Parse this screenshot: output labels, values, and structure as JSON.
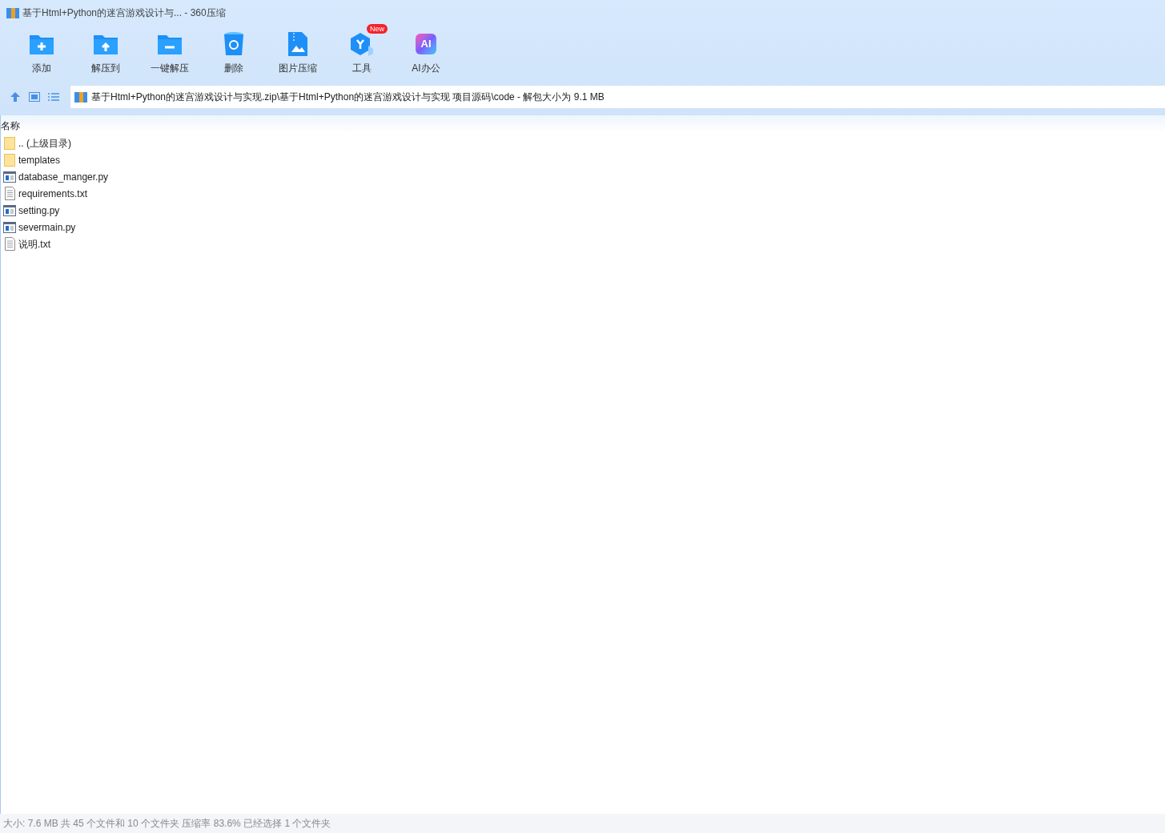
{
  "window": {
    "title": "基于Html+Python的迷宫游戏设计与... - 360压缩"
  },
  "toolbar": [
    {
      "kind": "add",
      "label": "添加"
    },
    {
      "kind": "extract",
      "label": "解压到"
    },
    {
      "kind": "oneclick",
      "label": "一键解压"
    },
    {
      "kind": "delete",
      "label": "删除"
    },
    {
      "kind": "image",
      "label": "图片压缩"
    },
    {
      "kind": "tools",
      "label": "工具",
      "badge": "New"
    },
    {
      "kind": "ai",
      "label": "AI办公",
      "icon_text": "AI"
    }
  ],
  "address": {
    "path": "基于Html+Python的迷宫游戏设计与实现.zip\\基于Html+Python的迷宫游戏设计与实现 项目源码\\code - 解包大小为 9.1 MB"
  },
  "list": {
    "column": "名称",
    "rows": [
      {
        "kind": "folder",
        "name": ".. (上级目录)"
      },
      {
        "kind": "folder",
        "name": "templates"
      },
      {
        "kind": "py",
        "name": "database_manger.py"
      },
      {
        "kind": "txt",
        "name": "requirements.txt"
      },
      {
        "kind": "py",
        "name": "setting.py"
      },
      {
        "kind": "py",
        "name": "severmain.py"
      },
      {
        "kind": "txt",
        "name": "说明.txt"
      }
    ]
  },
  "status_bar": "大小: 7.6 MB 共 45 个文件和 10 个文件夹 压缩率 83.6% 已经选择 1 个文件夹"
}
